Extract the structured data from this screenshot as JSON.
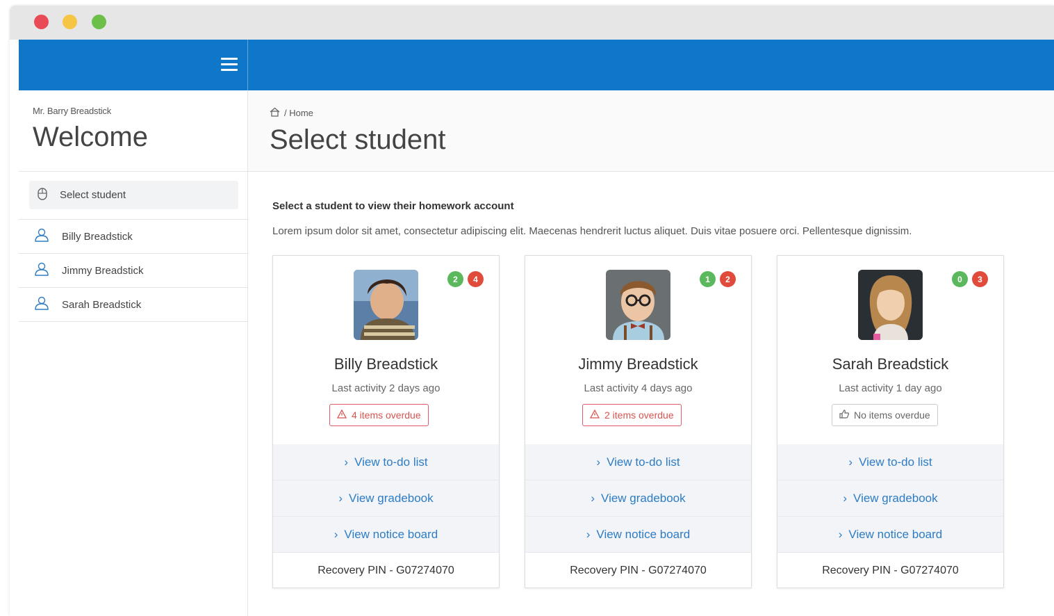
{
  "sidebar": {
    "user_name": "Mr. Barry Breadstick",
    "welcome": "Welcome",
    "active_item": "Select student",
    "items": [
      {
        "label": "Billy Breadstick"
      },
      {
        "label": "Jimmy Breadstick"
      },
      {
        "label": "Sarah Breadstick"
      }
    ]
  },
  "header": {
    "breadcrumb": "/ Home",
    "title": "Select student"
  },
  "intro": {
    "heading": "Select a student to view their homework account",
    "text": "Lorem ipsum dolor sit amet, consectetur adipiscing elit. Maecenas hendrerit luctus aliquet. Duis vitae posuere orci. Pellentesque dignissim."
  },
  "students": [
    {
      "name": "Billy Breadstick",
      "activity": "Last activity 2 days ago",
      "badge_green": "2",
      "badge_red": "4",
      "overdue": "4 items overdue",
      "links": [
        "View to-do list",
        "View gradebook",
        "View notice board"
      ],
      "pin": "Recovery PIN - G07274070"
    },
    {
      "name": "Jimmy Breadstick",
      "activity": "Last activity 4 days ago",
      "badge_green": "1",
      "badge_red": "2",
      "overdue": "2 items overdue",
      "links": [
        "View to-do list",
        "View gradebook",
        "View notice board"
      ],
      "pin": "Recovery PIN - G07274070"
    },
    {
      "name": "Sarah Breadstick",
      "activity": "Last activity 1 day ago",
      "badge_green": "0",
      "badge_red": "3",
      "overdue": "No items overdue",
      "links": [
        "View to-do list",
        "View gradebook",
        "View notice board"
      ],
      "pin": "Recovery PIN - G07274070"
    }
  ],
  "colors": {
    "topbar": "#0f77c9",
    "link": "#2d7cc4",
    "badge_green": "#5cb85c",
    "badge_red": "#e04b3c",
    "overdue": "#d9534f"
  }
}
